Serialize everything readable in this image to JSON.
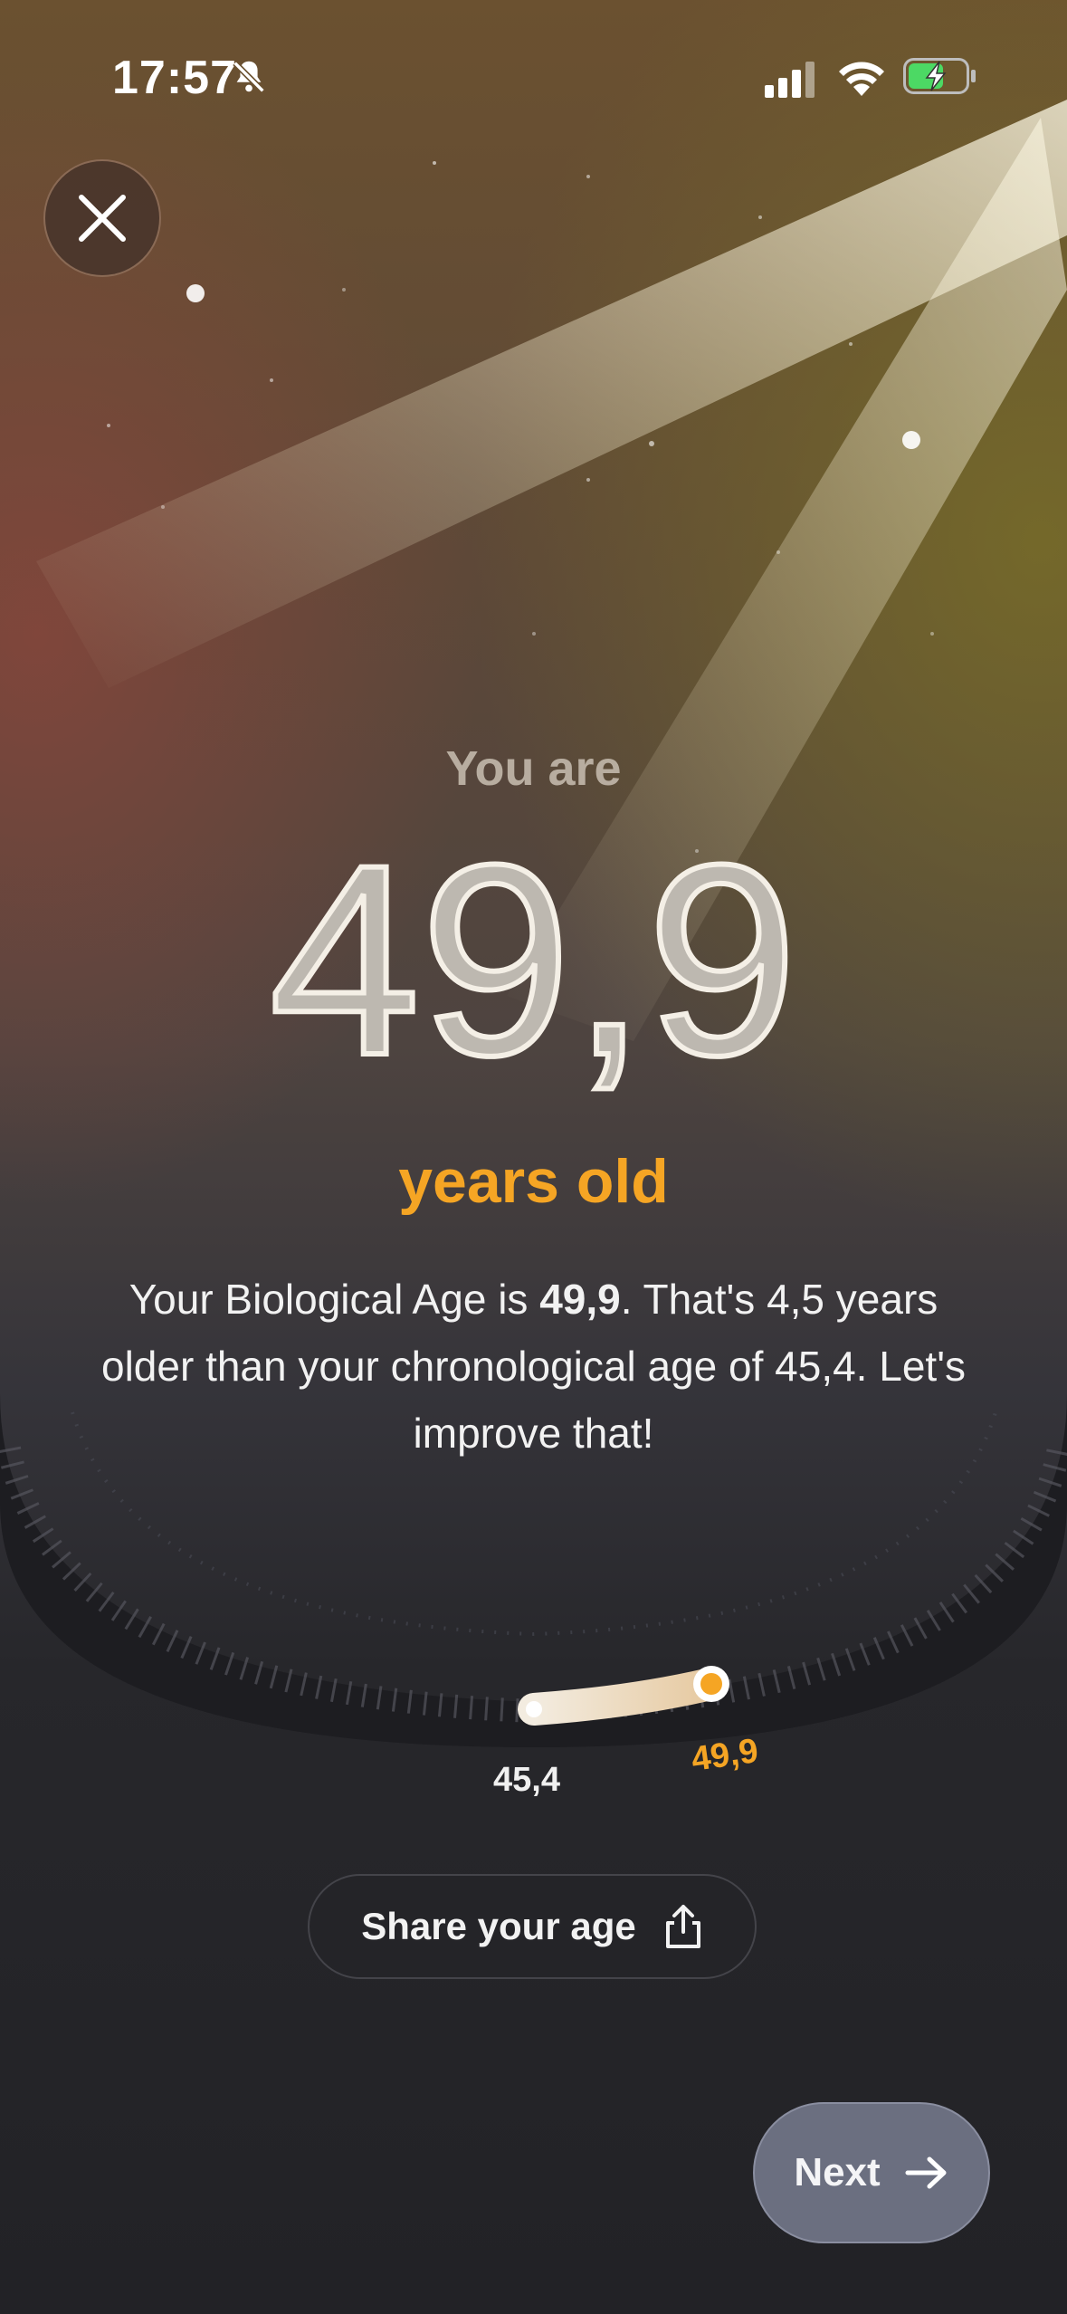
{
  "status_bar": {
    "time": "17:57",
    "icons": [
      "bell-slash-icon",
      "cellular-signal-icon",
      "wifi-icon",
      "battery-charging-icon"
    ]
  },
  "close_button": {
    "icon": "close-icon"
  },
  "result": {
    "intro": "You are",
    "age_value": "49,9",
    "unit": "years old"
  },
  "description": {
    "part1": "Your Biological Age is ",
    "bold_value": "49,9",
    "part2": ". That's 4,5 years older than your chronological age of 45,4. Let's improve that!"
  },
  "age_slider": {
    "chronological_label": "45,4",
    "biological_label": "49,9"
  },
  "share_button": {
    "label": "Share your age",
    "icon": "share-icon"
  },
  "next_button": {
    "label": "Next",
    "icon": "arrow-right-icon"
  },
  "colors": {
    "accent": "#f5a524",
    "next_bg": "#6b6f80"
  }
}
